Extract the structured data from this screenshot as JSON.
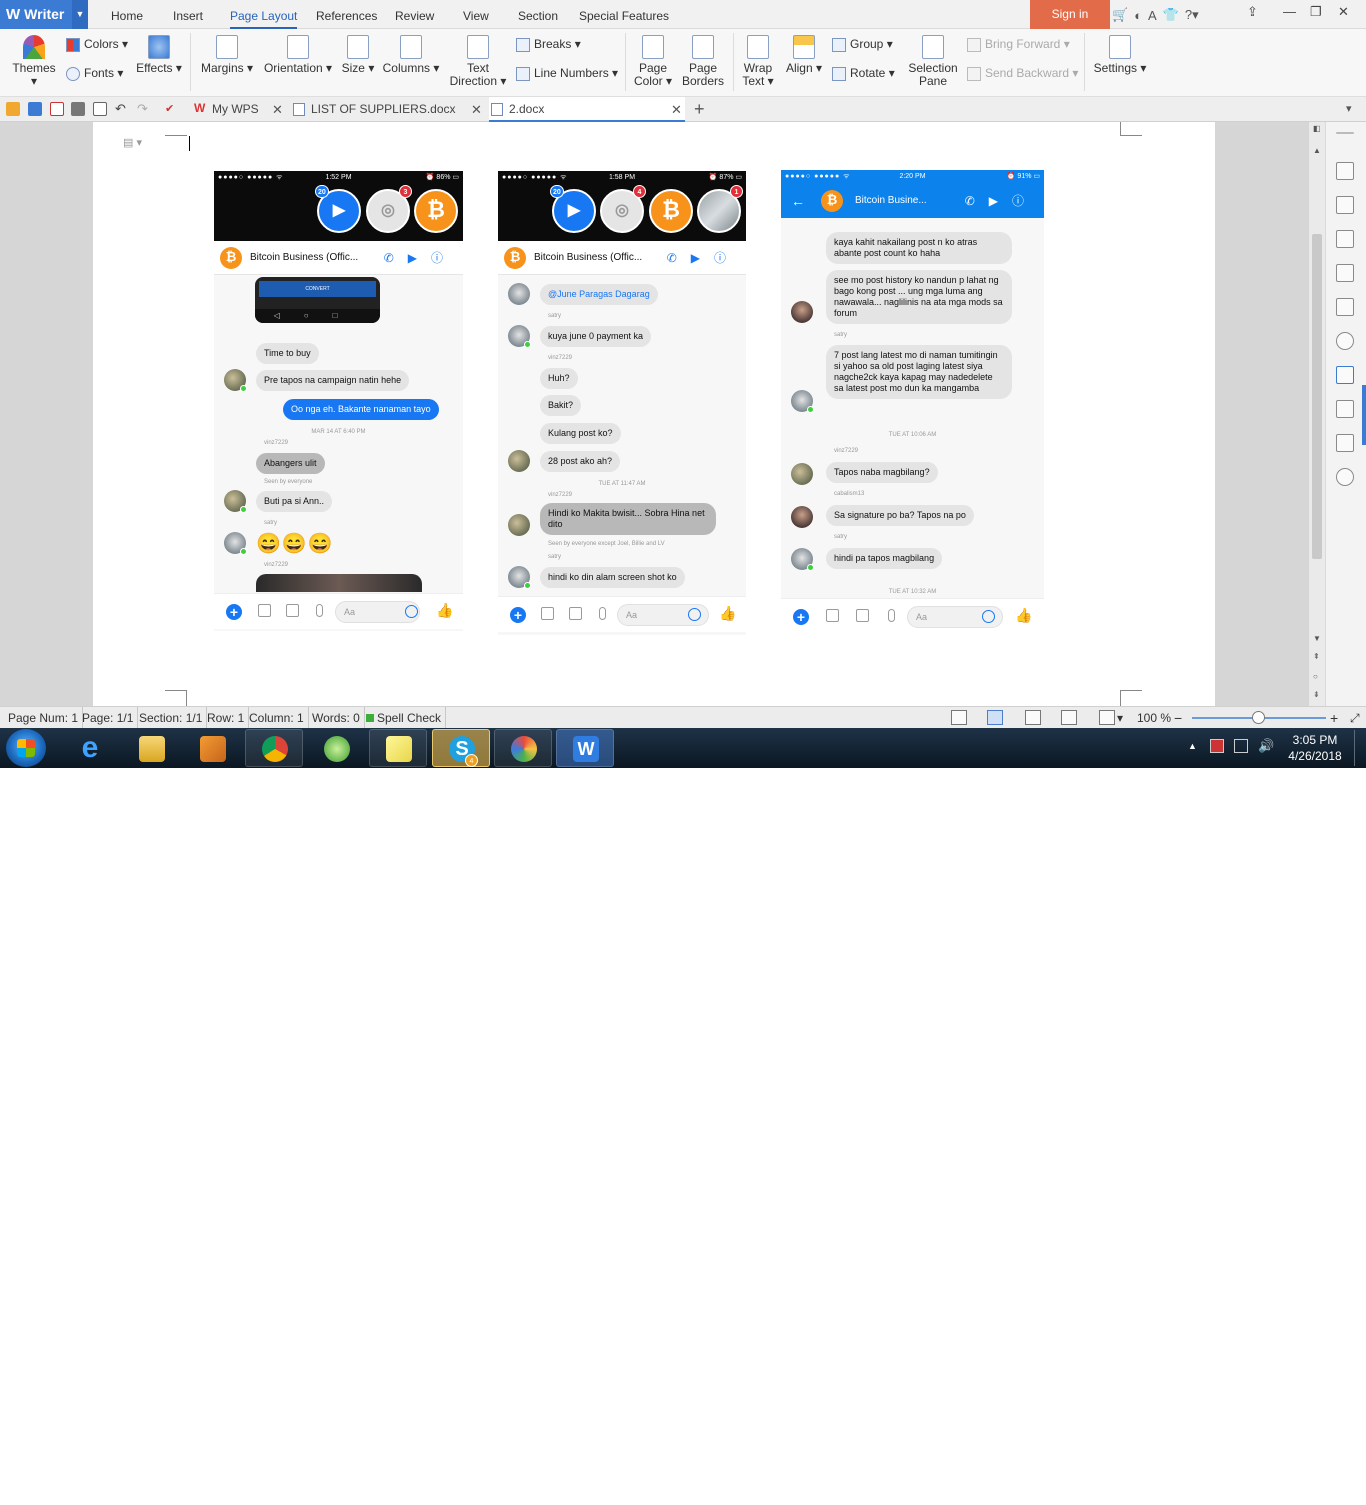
{
  "app": {
    "name": "Writer",
    "menu_tabs": [
      "Home",
      "Insert",
      "Page Layout",
      "References",
      "Review",
      "View",
      "Section",
      "Special Features"
    ],
    "active_tab": "Page Layout",
    "sign_in": "Sign in"
  },
  "ribbon": {
    "themes": "Themes",
    "colors": "Colors",
    "fonts": "Fonts",
    "effects": "Effects",
    "margins": "Margins",
    "orientation": "Orientation",
    "size": "Size",
    "columns": "Columns",
    "text_direction_1": "Text",
    "text_direction_2": "Direction",
    "breaks": "Breaks",
    "line_numbers": "Line Numbers",
    "page_color_1": "Page",
    "page_color_2": "Color",
    "page_borders_1": "Page",
    "page_borders_2": "Borders",
    "wrap_text_1": "Wrap",
    "wrap_text_2": "Text",
    "align": "Align",
    "group": "Group",
    "rotate": "Rotate",
    "selection_pane_1": "Selection",
    "selection_pane_2": "Pane",
    "bring_forward": "Bring Forward",
    "send_backward": "Send Backward",
    "settings": "Settings"
  },
  "doc_tabs": [
    {
      "label": "My WPS"
    },
    {
      "label": "LIST OF SUPPLIERS.docx"
    },
    {
      "label": "2.docx"
    }
  ],
  "phones": [
    {
      "time": "1:52 PM",
      "battery": "86%",
      "chathead_badges": [
        "20",
        "3"
      ],
      "chat_title": "Bitcoin Business (Offic...",
      "convert_button": "CONVERT",
      "messages": {
        "m1": "Time to buy",
        "m2": "Pre tapos na campaign natin hehe",
        "m3": "Oo nga eh. Bakante nanaman tayo",
        "ts1": "MAR 14 AT 6:40 PM",
        "n1": "vinz7229",
        "m4": "Abangers ulit",
        "seen": "Seen by everyone",
        "m5": "Buti pa si Ann..",
        "n2": "satry",
        "emoji": "😄😄😄",
        "n3": "vinz7229"
      },
      "composer_placeholder": "Aa"
    },
    {
      "time": "1:58 PM",
      "battery": "87%",
      "chathead_badges": [
        "20",
        "4",
        "1"
      ],
      "chat_title": "Bitcoin Business (Offic...",
      "messages": {
        "m1": "@June Paragas Dagarag",
        "n1": "satry",
        "m2": "kuya june 0 payment ka",
        "n2": "vinz7229",
        "m3": "Huh?",
        "m4": "Bakit?",
        "m5": "Kulang post ko?",
        "m6": "28 post ako ah?",
        "ts1": "TUE AT 11:47 AM",
        "n3": "vinz7229",
        "m7": "Hindi ko Makita bwisit... Sobra Hina net dito",
        "seen": "Seen by everyone except Joel, Billie and LV",
        "n4": "satry",
        "m8": "hindi ko din alam screen shot ko"
      },
      "composer_placeholder": "Aa"
    },
    {
      "time": "2:20 PM",
      "battery": "91%",
      "chat_title": "Bitcoin Busine...",
      "messages": {
        "m1": "kaya kahit nakailang post n ko atras abante post count ko haha",
        "m2": "see mo post history ko nandun p lahat ng bago kong post ... ung mga luma ang nawawala... naglilinis na ata mga mods sa forum",
        "n1": "satry",
        "m3": "7 post lang latest mo di naman tumitingin si yahoo sa old post laging latest siya nagche2ck kaya kapag may nadedelete sa latest post mo dun ka mangamba",
        "ts1": "TUE AT 10:06 AM",
        "n2": "vinz7229",
        "m4": "Tapos naba magbilang?",
        "n3": "cabalism13",
        "m5": "Sa signature po ba? Tapos na po",
        "n4": "satry",
        "m6": "hindi pa tapos magbilang",
        "ts2": "TUE AT 10:32 AM"
      },
      "composer_placeholder": "Aa"
    }
  ],
  "status_bar": {
    "page_num": "Page Num: 1",
    "page": "Page: 1/1",
    "section": "Section: 1/1",
    "row": "Row: 1",
    "column": "Column: 1",
    "words": "Words: 0",
    "spell_check": "Spell Check",
    "zoom": "100 %",
    "zoom_level_percent": 100
  },
  "taskbar": {
    "apps": [
      "internet-explorer",
      "file-explorer",
      "media-player",
      "chrome",
      "green-app",
      "sticky-notes",
      "skype",
      "paint",
      "wps-writer"
    ],
    "skype_badge": "4",
    "time": "3:05 PM",
    "date": "4/26/2018"
  },
  "colors": {
    "accent": "#3b7bd4",
    "signin": "#e26b49",
    "messenger_blue": "#1877f2",
    "bitcoin_orange": "#f7931a"
  }
}
